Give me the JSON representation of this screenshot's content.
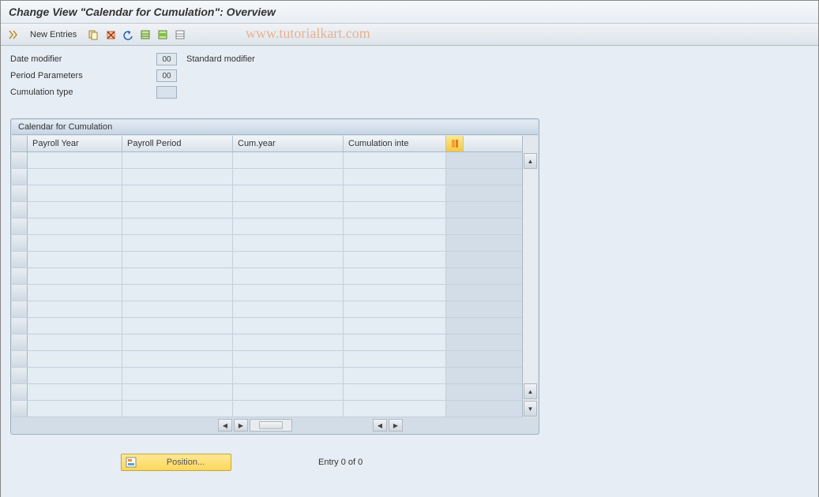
{
  "title": "Change View \"Calendar for Cumulation\": Overview",
  "toolbar": {
    "new_entries_label": "New Entries"
  },
  "watermark": "www.tutorialkart.com",
  "fields": {
    "date_modifier": {
      "label": "Date modifier",
      "value": "00",
      "desc": "Standard modifier"
    },
    "period_params": {
      "label": "Period Parameters",
      "value": "00"
    },
    "cumulation_type": {
      "label": "Cumulation type",
      "value": ""
    }
  },
  "panel": {
    "title": "Calendar for Cumulation",
    "columns": {
      "payroll_year": "Payroll Year",
      "payroll_period": "Payroll Period",
      "cum_year": "Cum.year",
      "cumulation_inte": "Cumulation inte"
    }
  },
  "footer": {
    "position_label": "Position...",
    "entry_text": "Entry 0 of 0"
  }
}
